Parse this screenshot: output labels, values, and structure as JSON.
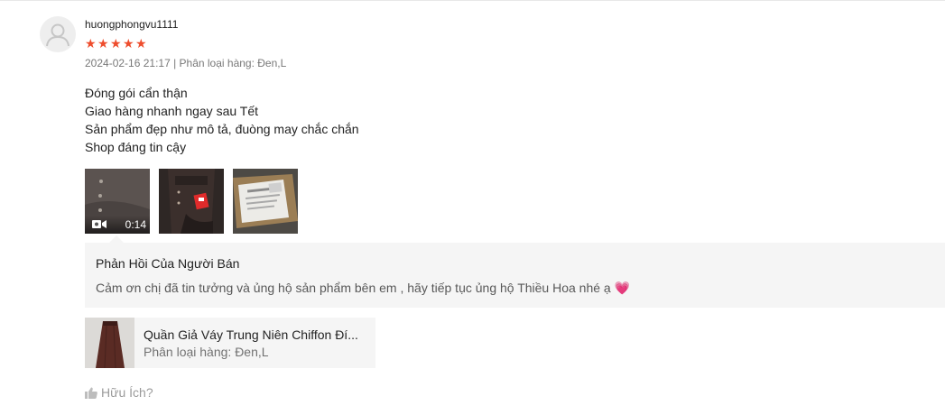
{
  "review": {
    "username": "huongphongvu1111",
    "rating": 5,
    "stars": [
      "★",
      "★",
      "★",
      "★",
      "★"
    ],
    "meta": "2024-02-16 21:17 | Phân loại hàng: Đen,L",
    "lines": [
      "Đóng gói cẩn thận",
      "Giao hàng nhanh ngay sau Tết",
      "Sản phẩm đẹp như mô tả, đuòng may chắc chắn",
      "Shop đáng tin cậy"
    ],
    "media": [
      {
        "type": "video",
        "duration": "0:14"
      },
      {
        "type": "image"
      },
      {
        "type": "image"
      }
    ]
  },
  "seller_reply": {
    "title": "Phản Hồi Của Người Bán",
    "text": "Cảm ơn chị đã tin tưởng và ủng hộ sản phẩm bên em , hãy tiếp tục ủng hộ Thiều Hoa nhé ạ",
    "emoji": "💗"
  },
  "product": {
    "name": "Quần Giả Váy Trung Niên Chiffon Đí...",
    "variation": "Phân loại hàng: Đen,L"
  },
  "helpful": {
    "label": "Hữu Ích?"
  },
  "colors": {
    "star": "#ee4d2d",
    "reply_bg": "#f5f5f5",
    "heart": "#ee6ea6"
  }
}
